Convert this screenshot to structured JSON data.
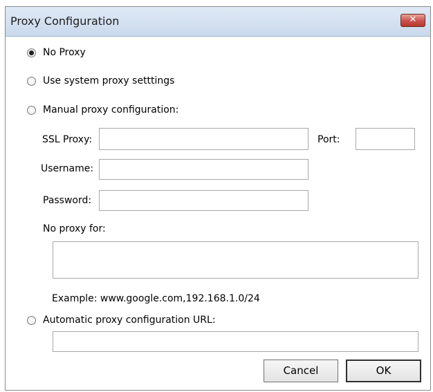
{
  "window": {
    "title": "Proxy Configuration",
    "close_symbol": "✕"
  },
  "options": {
    "no_proxy": "No Proxy",
    "system_proxy": "Use system proxy setttings",
    "manual_proxy": "Manual proxy configuration:",
    "auto_proxy": "Automatic proxy configuration URL:",
    "selected": "no_proxy"
  },
  "manual": {
    "ssl_proxy_label": "SSL Proxy:",
    "ssl_proxy_value": "",
    "port_label": "Port:",
    "port_value": "",
    "username_label": "Username:",
    "username_value": "",
    "password_label": "Password:",
    "password_value": "",
    "no_proxy_for_label": "No proxy for:",
    "no_proxy_for_value": "",
    "example_text": "Example: www.google.com,192.168.1.0/24"
  },
  "auto": {
    "url_value": ""
  },
  "buttons": {
    "cancel": "Cancel",
    "ok": "OK"
  },
  "icons": {
    "close": "close-icon"
  }
}
